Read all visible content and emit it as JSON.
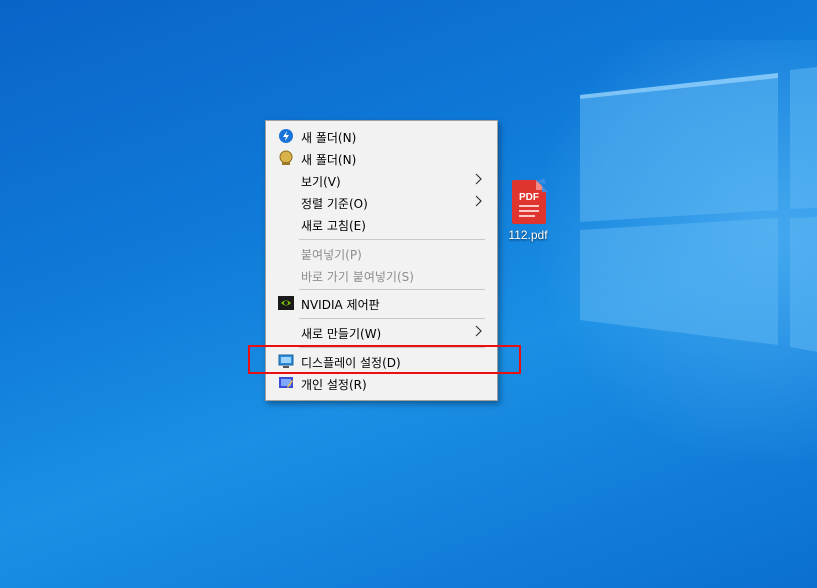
{
  "desktop": {
    "file": {
      "name": "112.pdf",
      "icon": "pdf-file-icon",
      "badge_text": "PDF"
    }
  },
  "context_menu": {
    "items": [
      {
        "label": "새 폴더(N)",
        "icon": "blue-bolt-icon"
      },
      {
        "label": "새 폴더(N)",
        "icon": "gold-badge-icon"
      },
      {
        "label": "보기(V)",
        "submenu": true
      },
      {
        "label": "정렬 기준(O)",
        "submenu": true
      },
      {
        "label": "새로 고침(E)"
      },
      {
        "label": "붙여넣기(P)",
        "disabled": true
      },
      {
        "label": "바로 가기 붙여넣기(S)",
        "disabled": true
      },
      {
        "label": "NVIDIA 제어판",
        "icon": "nvidia-icon"
      },
      {
        "label": "새로 만들기(W)",
        "submenu": true
      },
      {
        "label": "디스플레이 설정(D)",
        "icon": "display-icon",
        "highlighted": true
      },
      {
        "label": "개인 설정(R)",
        "icon": "personalize-icon"
      }
    ]
  },
  "colors": {
    "desktop_blue": "#0f7ad8",
    "menu_bg": "#f2f2f2",
    "highlight_border": "#e81010",
    "disabled_text": "#8e8e8e"
  }
}
